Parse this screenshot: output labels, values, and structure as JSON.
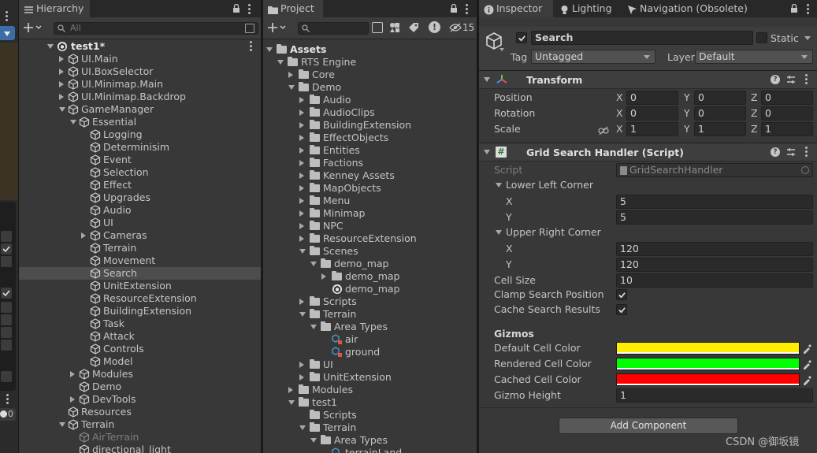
{
  "hierarchy": {
    "tab_label": "Hierarchy",
    "search_placeholder": "All",
    "scene_name": "test1*",
    "rows": [
      {
        "label": "UI.Main",
        "depth": 1,
        "arrow": "right",
        "icon": "cube"
      },
      {
        "label": "UI.BoxSelector",
        "depth": 1,
        "arrow": "right",
        "icon": "cube"
      },
      {
        "label": "UI.Minimap.Main",
        "depth": 1,
        "arrow": "right",
        "icon": "cube"
      },
      {
        "label": "UI.Minimap.Backdrop",
        "depth": 1,
        "arrow": "right",
        "icon": "cube"
      },
      {
        "label": "GameManager",
        "depth": 1,
        "arrow": "down",
        "icon": "cube"
      },
      {
        "label": "Essential",
        "depth": 2,
        "arrow": "down",
        "icon": "cube"
      },
      {
        "label": "Logging",
        "depth": 3,
        "arrow": "",
        "icon": "cube"
      },
      {
        "label": "Determinisim",
        "depth": 3,
        "arrow": "",
        "icon": "cube"
      },
      {
        "label": "Event",
        "depth": 3,
        "arrow": "",
        "icon": "cube"
      },
      {
        "label": "Selection",
        "depth": 3,
        "arrow": "",
        "icon": "cube"
      },
      {
        "label": "Effect",
        "depth": 3,
        "arrow": "",
        "icon": "cube"
      },
      {
        "label": "Upgrades",
        "depth": 3,
        "arrow": "",
        "icon": "cube"
      },
      {
        "label": "Audio",
        "depth": 3,
        "arrow": "",
        "icon": "cube"
      },
      {
        "label": "UI",
        "depth": 3,
        "arrow": "",
        "icon": "cube"
      },
      {
        "label": "Cameras",
        "depth": 3,
        "arrow": "right",
        "icon": "cube"
      },
      {
        "label": "Terrain",
        "depth": 3,
        "arrow": "",
        "icon": "cube"
      },
      {
        "label": "Movement",
        "depth": 3,
        "arrow": "",
        "icon": "cube"
      },
      {
        "label": "Search",
        "depth": 3,
        "arrow": "",
        "icon": "cube",
        "selected": true
      },
      {
        "label": "UnitExtension",
        "depth": 3,
        "arrow": "",
        "icon": "cube"
      },
      {
        "label": "ResourceExtension",
        "depth": 3,
        "arrow": "",
        "icon": "cube"
      },
      {
        "label": "BuildingExtension",
        "depth": 3,
        "arrow": "",
        "icon": "cube"
      },
      {
        "label": "Task",
        "depth": 3,
        "arrow": "",
        "icon": "cube"
      },
      {
        "label": "Attack",
        "depth": 3,
        "arrow": "",
        "icon": "cube"
      },
      {
        "label": "Controls",
        "depth": 3,
        "arrow": "",
        "icon": "cube"
      },
      {
        "label": "Model",
        "depth": 3,
        "arrow": "",
        "icon": "cube"
      },
      {
        "label": "Modules",
        "depth": 2,
        "arrow": "right",
        "icon": "cube"
      },
      {
        "label": "Demo",
        "depth": 2,
        "arrow": "",
        "icon": "cube"
      },
      {
        "label": "DevTools",
        "depth": 2,
        "arrow": "right",
        "icon": "cube"
      },
      {
        "label": "Resources",
        "depth": 1,
        "arrow": "",
        "icon": "cube"
      },
      {
        "label": "Terrain",
        "depth": 1,
        "arrow": "down",
        "icon": "cube"
      },
      {
        "label": "AirTerrain",
        "depth": 2,
        "arrow": "",
        "icon": "cube",
        "dim": true
      },
      {
        "label": "directional_light",
        "depth": 2,
        "arrow": "",
        "icon": "cube"
      }
    ]
  },
  "project": {
    "tab_label": "Project",
    "hidden_count": "15",
    "rows": [
      {
        "label": "Assets",
        "depth": 0,
        "arrow": "down",
        "icon": "folder",
        "bold": true
      },
      {
        "label": "RTS Engine",
        "depth": 1,
        "arrow": "down",
        "icon": "folder"
      },
      {
        "label": "Core",
        "depth": 2,
        "arrow": "right",
        "icon": "folder"
      },
      {
        "label": "Demo",
        "depth": 2,
        "arrow": "down",
        "icon": "folder"
      },
      {
        "label": "Audio",
        "depth": 3,
        "arrow": "right",
        "icon": "folder"
      },
      {
        "label": "AudioClips",
        "depth": 3,
        "arrow": "right",
        "icon": "folder"
      },
      {
        "label": "BuildingExtension",
        "depth": 3,
        "arrow": "right",
        "icon": "folder"
      },
      {
        "label": "EffectObjects",
        "depth": 3,
        "arrow": "right",
        "icon": "folder"
      },
      {
        "label": "Entities",
        "depth": 3,
        "arrow": "right",
        "icon": "folder"
      },
      {
        "label": "Factions",
        "depth": 3,
        "arrow": "right",
        "icon": "folder"
      },
      {
        "label": "Kenney Assets",
        "depth": 3,
        "arrow": "right",
        "icon": "folder"
      },
      {
        "label": "MapObjects",
        "depth": 3,
        "arrow": "right",
        "icon": "folder"
      },
      {
        "label": "Menu",
        "depth": 3,
        "arrow": "right",
        "icon": "folder"
      },
      {
        "label": "Minimap",
        "depth": 3,
        "arrow": "right",
        "icon": "folder"
      },
      {
        "label": "NPC",
        "depth": 3,
        "arrow": "right",
        "icon": "folder"
      },
      {
        "label": "ResourceExtension",
        "depth": 3,
        "arrow": "right",
        "icon": "folder"
      },
      {
        "label": "Scenes",
        "depth": 3,
        "arrow": "down",
        "icon": "folder"
      },
      {
        "label": "demo_map",
        "depth": 4,
        "arrow": "down",
        "icon": "folder"
      },
      {
        "label": "demo_map",
        "depth": 5,
        "arrow": "right",
        "icon": "folder"
      },
      {
        "label": "demo_map",
        "depth": 5,
        "arrow": "",
        "icon": "unity"
      },
      {
        "label": "Scripts",
        "depth": 3,
        "arrow": "right",
        "icon": "folder"
      },
      {
        "label": "Terrain",
        "depth": 3,
        "arrow": "down",
        "icon": "folder"
      },
      {
        "label": "Area Types",
        "depth": 4,
        "arrow": "down",
        "icon": "folder"
      },
      {
        "label": "air",
        "depth": 5,
        "arrow": "",
        "icon": "asset"
      },
      {
        "label": "ground",
        "depth": 5,
        "arrow": "",
        "icon": "asset"
      },
      {
        "label": "UI",
        "depth": 3,
        "arrow": "right",
        "icon": "folder"
      },
      {
        "label": "UnitExtension",
        "depth": 3,
        "arrow": "right",
        "icon": "folder"
      },
      {
        "label": "Modules",
        "depth": 2,
        "arrow": "right",
        "icon": "folder"
      },
      {
        "label": "test1",
        "depth": 2,
        "arrow": "down",
        "icon": "folder"
      },
      {
        "label": "Scripts",
        "depth": 3,
        "arrow": "",
        "icon": "folder"
      },
      {
        "label": "Terrain",
        "depth": 3,
        "arrow": "down",
        "icon": "folder"
      },
      {
        "label": "Area Types",
        "depth": 4,
        "arrow": "down",
        "icon": "folder"
      },
      {
        "label": "terrainLand",
        "depth": 5,
        "arrow": "",
        "icon": "asset"
      }
    ]
  },
  "inspector": {
    "tabs": [
      "Inspector",
      "Lighting",
      "Navigation (Obsolete)"
    ],
    "object_name": "Search",
    "static_label": "Static",
    "tag_label": "Tag",
    "tag_value": "Untagged",
    "layer_label": "Layer",
    "layer_value": "Default",
    "transform": {
      "title": "Transform",
      "position_label": "Position",
      "rotation_label": "Rotation",
      "scale_label": "Scale",
      "position": [
        "0",
        "0",
        "0"
      ],
      "rotation": [
        "0",
        "0",
        "0"
      ],
      "scale": [
        "1",
        "1",
        "1"
      ],
      "axes": [
        "X",
        "Y",
        "Z"
      ]
    },
    "script_component": {
      "title": "Grid Search Handler (Script)",
      "script_label": "Script",
      "script_value": "GridSearchHandler",
      "lower_left_label": "Lower Left Corner",
      "upper_right_label": "Upper Right Corner",
      "x_label": "X",
      "y_label": "Y",
      "lower_left_x": "5",
      "lower_left_y": "5",
      "upper_right_x": "120",
      "upper_right_y": "120",
      "cell_size_label": "Cell Size",
      "cell_size": "10",
      "clamp_label": "Clamp Search Position",
      "cache_label": "Cache Search Results",
      "gizmos_label": "Gizmos",
      "default_color_label": "Default Cell Color",
      "rendered_color_label": "Rendered Cell Color",
      "cached_color_label": "Cached Cell Color",
      "gizmo_height_label": "Gizmo Height",
      "gizmo_height": "1",
      "default_color": "#ffee00",
      "rendered_color": "#00ff00",
      "cached_color": "#ff0000"
    },
    "add_component_label": "Add Component"
  },
  "left_strip": {
    "counter": "0"
  },
  "top_strip": {
    "layer_dropdown": "Layer"
  },
  "watermark": "CSDN @御坂镜"
}
